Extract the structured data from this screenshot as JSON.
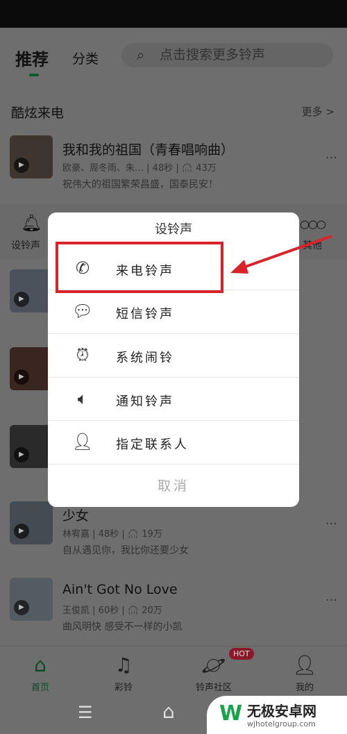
{
  "header": {
    "tabs": [
      "推荐",
      "分类"
    ],
    "search_placeholder": "点击搜索更多铃声"
  },
  "section": {
    "title": "酷炫来电",
    "more": "更多 >"
  },
  "songs": [
    {
      "title": "我和我的祖国（青春唱响曲）",
      "artist": "欧豪、周冬雨、朱…",
      "duration": "48秒",
      "plays": "43万",
      "desc": "祝伟大的祖国繁荣昌盛，国泰民安！"
    },
    {
      "title": "少女",
      "artist": "林宥嘉",
      "duration": "48秒",
      "plays": "19万",
      "desc": "自从遇见你，我比你还要少女"
    },
    {
      "title": "Ain't Got No Love",
      "artist": "王俊凯",
      "duration": "60秒",
      "plays": "20万",
      "desc": "曲风明快  感受不一样的小凯"
    }
  ],
  "actions": {
    "set_ringtone": "设铃声",
    "other": "其他"
  },
  "dialog": {
    "title": "设铃声",
    "options": [
      "来电铃声",
      "短信铃声",
      "系统闹铃",
      "通知铃声",
      "指定联系人"
    ],
    "cancel": "取消"
  },
  "nav": {
    "items": [
      "首页",
      "彩铃",
      "铃声社区",
      "我的"
    ],
    "hot_badge": "HOT"
  },
  "colors": {
    "accent": "#1a8c4e",
    "highlight": "#d9232a",
    "hot": "#d9233f"
  },
  "watermark": {
    "name": "无极安卓网",
    "url": "wjhotelgroup.com"
  }
}
